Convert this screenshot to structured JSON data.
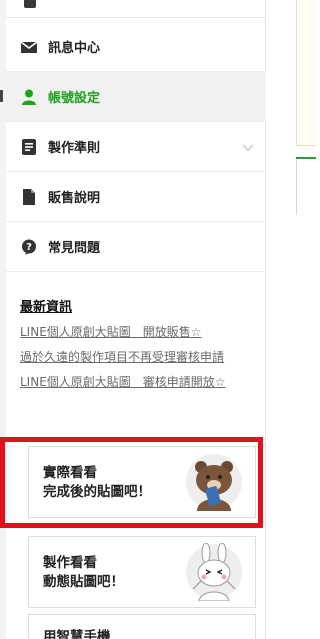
{
  "sidebar": {
    "items": [
      {
        "label": "訊息中心",
        "icon": "mail-icon"
      },
      {
        "label": "帳號設定",
        "icon": "user-icon",
        "active": true
      },
      {
        "label": "製作準則",
        "icon": "document-icon",
        "expandable": true
      },
      {
        "label": "販售說明",
        "icon": "file-icon"
      },
      {
        "label": "常見問題",
        "icon": "question-bubble-icon"
      }
    ]
  },
  "news": {
    "title": "最新資訊",
    "links": [
      "LINE個人原創大貼圖　開放販售☆",
      "過於久遠的製作項目不再受理審核申請",
      "LINE個人原創大貼圖　審核申請開放☆"
    ]
  },
  "promos": [
    {
      "line1": "實際看看",
      "line2": "完成後的貼圖吧！",
      "art": "brown-bear-phone-art"
    },
    {
      "line1": "製作看看",
      "line2": "動態貼圖吧！",
      "art": "cony-bunny-art"
    },
    {
      "line1": "用智慧手機"
    }
  ],
  "colors": {
    "active_green": "#21a21d",
    "highlight_red": "#e3111b",
    "right_line_green": "#2f9c3a"
  }
}
